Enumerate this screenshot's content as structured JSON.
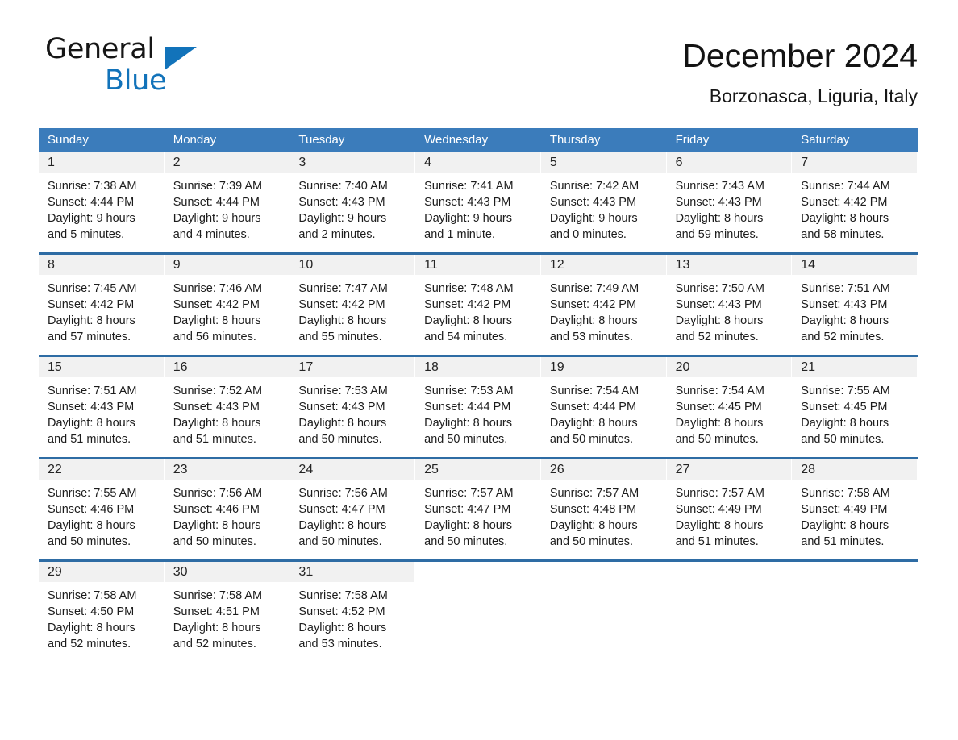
{
  "brand": {
    "name_part1": "General",
    "name_part2": "Blue",
    "accent_color": "#1273ba",
    "triangle_icon": "triangle-icon"
  },
  "header": {
    "title": "December 2024",
    "location": "Borzonasca, Liguria, Italy"
  },
  "calendar": {
    "header_bg": "#3b7cbb",
    "row_divider_color": "#2e6ca4",
    "daynum_band_bg": "#f1f1f1",
    "day_names": [
      "Sunday",
      "Monday",
      "Tuesday",
      "Wednesday",
      "Thursday",
      "Friday",
      "Saturday"
    ],
    "weeks": [
      [
        {
          "day": "1",
          "sunrise": "Sunrise: 7:38 AM",
          "sunset": "Sunset: 4:44 PM",
          "daylight": "Daylight: 9 hours and 5 minutes."
        },
        {
          "day": "2",
          "sunrise": "Sunrise: 7:39 AM",
          "sunset": "Sunset: 4:44 PM",
          "daylight": "Daylight: 9 hours and 4 minutes."
        },
        {
          "day": "3",
          "sunrise": "Sunrise: 7:40 AM",
          "sunset": "Sunset: 4:43 PM",
          "daylight": "Daylight: 9 hours and 2 minutes."
        },
        {
          "day": "4",
          "sunrise": "Sunrise: 7:41 AM",
          "sunset": "Sunset: 4:43 PM",
          "daylight": "Daylight: 9 hours and 1 minute."
        },
        {
          "day": "5",
          "sunrise": "Sunrise: 7:42 AM",
          "sunset": "Sunset: 4:43 PM",
          "daylight": "Daylight: 9 hours and 0 minutes."
        },
        {
          "day": "6",
          "sunrise": "Sunrise: 7:43 AM",
          "sunset": "Sunset: 4:43 PM",
          "daylight": "Daylight: 8 hours and 59 minutes."
        },
        {
          "day": "7",
          "sunrise": "Sunrise: 7:44 AM",
          "sunset": "Sunset: 4:42 PM",
          "daylight": "Daylight: 8 hours and 58 minutes."
        }
      ],
      [
        {
          "day": "8",
          "sunrise": "Sunrise: 7:45 AM",
          "sunset": "Sunset: 4:42 PM",
          "daylight": "Daylight: 8 hours and 57 minutes."
        },
        {
          "day": "9",
          "sunrise": "Sunrise: 7:46 AM",
          "sunset": "Sunset: 4:42 PM",
          "daylight": "Daylight: 8 hours and 56 minutes."
        },
        {
          "day": "10",
          "sunrise": "Sunrise: 7:47 AM",
          "sunset": "Sunset: 4:42 PM",
          "daylight": "Daylight: 8 hours and 55 minutes."
        },
        {
          "day": "11",
          "sunrise": "Sunrise: 7:48 AM",
          "sunset": "Sunset: 4:42 PM",
          "daylight": "Daylight: 8 hours and 54 minutes."
        },
        {
          "day": "12",
          "sunrise": "Sunrise: 7:49 AM",
          "sunset": "Sunset: 4:42 PM",
          "daylight": "Daylight: 8 hours and 53 minutes."
        },
        {
          "day": "13",
          "sunrise": "Sunrise: 7:50 AM",
          "sunset": "Sunset: 4:43 PM",
          "daylight": "Daylight: 8 hours and 52 minutes."
        },
        {
          "day": "14",
          "sunrise": "Sunrise: 7:51 AM",
          "sunset": "Sunset: 4:43 PM",
          "daylight": "Daylight: 8 hours and 52 minutes."
        }
      ],
      [
        {
          "day": "15",
          "sunrise": "Sunrise: 7:51 AM",
          "sunset": "Sunset: 4:43 PM",
          "daylight": "Daylight: 8 hours and 51 minutes."
        },
        {
          "day": "16",
          "sunrise": "Sunrise: 7:52 AM",
          "sunset": "Sunset: 4:43 PM",
          "daylight": "Daylight: 8 hours and 51 minutes."
        },
        {
          "day": "17",
          "sunrise": "Sunrise: 7:53 AM",
          "sunset": "Sunset: 4:43 PM",
          "daylight": "Daylight: 8 hours and 50 minutes."
        },
        {
          "day": "18",
          "sunrise": "Sunrise: 7:53 AM",
          "sunset": "Sunset: 4:44 PM",
          "daylight": "Daylight: 8 hours and 50 minutes."
        },
        {
          "day": "19",
          "sunrise": "Sunrise: 7:54 AM",
          "sunset": "Sunset: 4:44 PM",
          "daylight": "Daylight: 8 hours and 50 minutes."
        },
        {
          "day": "20",
          "sunrise": "Sunrise: 7:54 AM",
          "sunset": "Sunset: 4:45 PM",
          "daylight": "Daylight: 8 hours and 50 minutes."
        },
        {
          "day": "21",
          "sunrise": "Sunrise: 7:55 AM",
          "sunset": "Sunset: 4:45 PM",
          "daylight": "Daylight: 8 hours and 50 minutes."
        }
      ],
      [
        {
          "day": "22",
          "sunrise": "Sunrise: 7:55 AM",
          "sunset": "Sunset: 4:46 PM",
          "daylight": "Daylight: 8 hours and 50 minutes."
        },
        {
          "day": "23",
          "sunrise": "Sunrise: 7:56 AM",
          "sunset": "Sunset: 4:46 PM",
          "daylight": "Daylight: 8 hours and 50 minutes."
        },
        {
          "day": "24",
          "sunrise": "Sunrise: 7:56 AM",
          "sunset": "Sunset: 4:47 PM",
          "daylight": "Daylight: 8 hours and 50 minutes."
        },
        {
          "day": "25",
          "sunrise": "Sunrise: 7:57 AM",
          "sunset": "Sunset: 4:47 PM",
          "daylight": "Daylight: 8 hours and 50 minutes."
        },
        {
          "day": "26",
          "sunrise": "Sunrise: 7:57 AM",
          "sunset": "Sunset: 4:48 PM",
          "daylight": "Daylight: 8 hours and 50 minutes."
        },
        {
          "day": "27",
          "sunrise": "Sunrise: 7:57 AM",
          "sunset": "Sunset: 4:49 PM",
          "daylight": "Daylight: 8 hours and 51 minutes."
        },
        {
          "day": "28",
          "sunrise": "Sunrise: 7:58 AM",
          "sunset": "Sunset: 4:49 PM",
          "daylight": "Daylight: 8 hours and 51 minutes."
        }
      ],
      [
        {
          "day": "29",
          "sunrise": "Sunrise: 7:58 AM",
          "sunset": "Sunset: 4:50 PM",
          "daylight": "Daylight: 8 hours and 52 minutes."
        },
        {
          "day": "30",
          "sunrise": "Sunrise: 7:58 AM",
          "sunset": "Sunset: 4:51 PM",
          "daylight": "Daylight: 8 hours and 52 minutes."
        },
        {
          "day": "31",
          "sunrise": "Sunrise: 7:58 AM",
          "sunset": "Sunset: 4:52 PM",
          "daylight": "Daylight: 8 hours and 53 minutes."
        },
        {
          "day": "",
          "sunrise": "",
          "sunset": "",
          "daylight": ""
        },
        {
          "day": "",
          "sunrise": "",
          "sunset": "",
          "daylight": ""
        },
        {
          "day": "",
          "sunrise": "",
          "sunset": "",
          "daylight": ""
        },
        {
          "day": "",
          "sunrise": "",
          "sunset": "",
          "daylight": ""
        }
      ]
    ]
  }
}
